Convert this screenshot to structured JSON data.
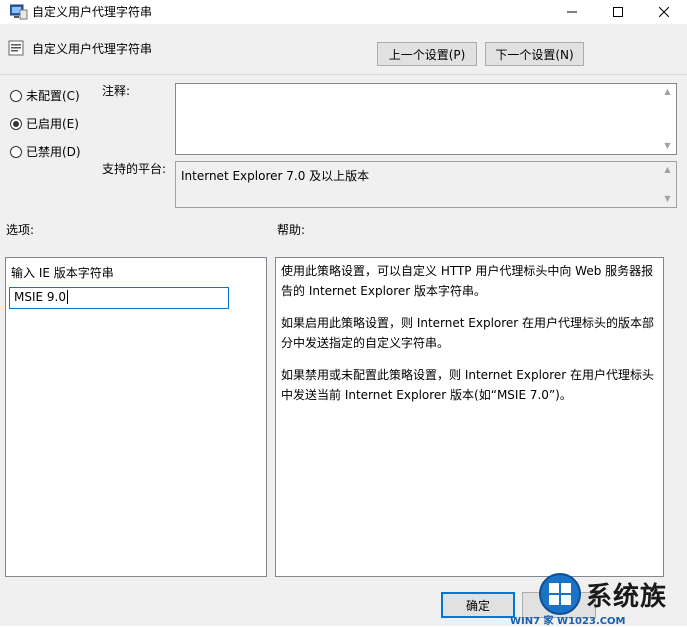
{
  "window": {
    "title": "自定义用户代理字符串"
  },
  "header": {
    "policy_name": "自定义用户代理字符串",
    "prev_label": "上一个设置(P)",
    "next_label": "下一个设置(N)"
  },
  "state": {
    "options": [
      {
        "label": "未配置(C)",
        "selected": false
      },
      {
        "label": "已启用(E)",
        "selected": true
      },
      {
        "label": "已禁用(D)",
        "selected": false
      }
    ]
  },
  "comment": {
    "label": "注释:",
    "value": ""
  },
  "platform": {
    "label": "支持的平台:",
    "value": "Internet Explorer 7.0 及以上版本"
  },
  "options_section": {
    "label": "选项:",
    "field_label": "输入 IE 版本字符串",
    "field_value": "MSIE 9.0"
  },
  "help_section": {
    "label": "帮助:",
    "paragraphs": [
      "使用此策略设置，可以自定义 HTTP 用户代理标头中向 Web 服务器报告的 Internet Explorer 版本字符串。",
      "如果启用此策略设置，则 Internet Explorer 在用户代理标头的版本部分中发送指定的自定义字符串。",
      "如果禁用或未配置此策略设置，则 Internet Explorer 在用户代理标头中发送当前 Internet Explorer 版本(如“MSIE 7.0”)。"
    ]
  },
  "footer": {
    "ok_label": "确定"
  },
  "watermark": {
    "brand": "系统族",
    "site": "WIN7 家 W1023.COM"
  }
}
